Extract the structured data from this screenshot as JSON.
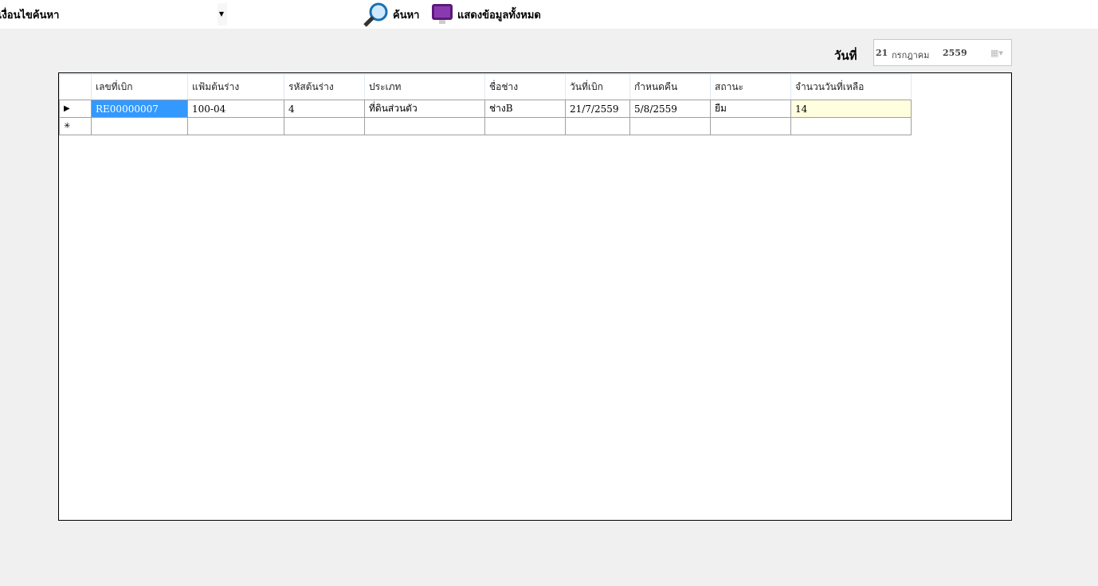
{
  "search": {
    "label": "เงื่อนไขค้นหา :",
    "value": ""
  },
  "toolbar": {
    "search_label": "ค้นหา",
    "show_all_label": "แสดงข้อมูลทั้งหมด"
  },
  "date": {
    "label": "วันที่",
    "day": "21",
    "month": "กรกฎาคม",
    "year": "2559"
  },
  "table": {
    "columns": [
      "เลขที่เบิก",
      "แฟ้มต้นร่าง",
      "รหัสต้นร่าง",
      "ประเภท",
      "ชื่อช่าง",
      "วันที่เบิก",
      "กำหนดคืน",
      "สถานะ",
      "จำนวนวันที่เหลือ"
    ],
    "rows": [
      [
        "RE00000007",
        "100-04",
        "4",
        "ที่ดินส่วนตัว",
        "ช่างB",
        "21/7/2559",
        "5/8/2559",
        "ยืม",
        "14"
      ]
    ],
    "current_row_marker": "▶",
    "new_row_marker": "✳"
  }
}
